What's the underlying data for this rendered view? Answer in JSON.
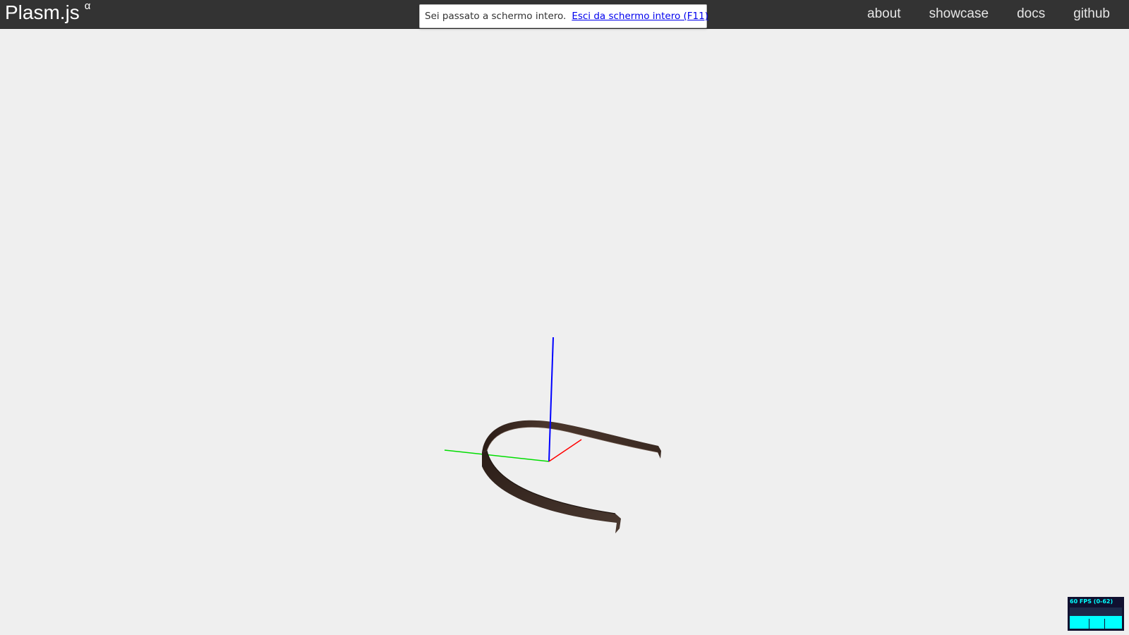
{
  "header": {
    "brand": "Plasm.js",
    "brand_sup": "α",
    "nav": [
      {
        "label": "about"
      },
      {
        "label": "showcase"
      },
      {
        "label": "docs"
      },
      {
        "label": "github"
      }
    ]
  },
  "fullscreen_notice": {
    "message": "Sei passato a schermo intero.",
    "exit_link": "Esci da schermo intero (F11)"
  },
  "scene": {
    "axis_colors": {
      "x": "#ff0000",
      "y": "#00dd00",
      "z": "#0000ff"
    },
    "model_color": "#3b2a22"
  },
  "fps_meter": {
    "label": "60 FPS (0-62)",
    "level": 0.6
  },
  "colors": {
    "topbar": "#333333",
    "background": "#efefef"
  }
}
